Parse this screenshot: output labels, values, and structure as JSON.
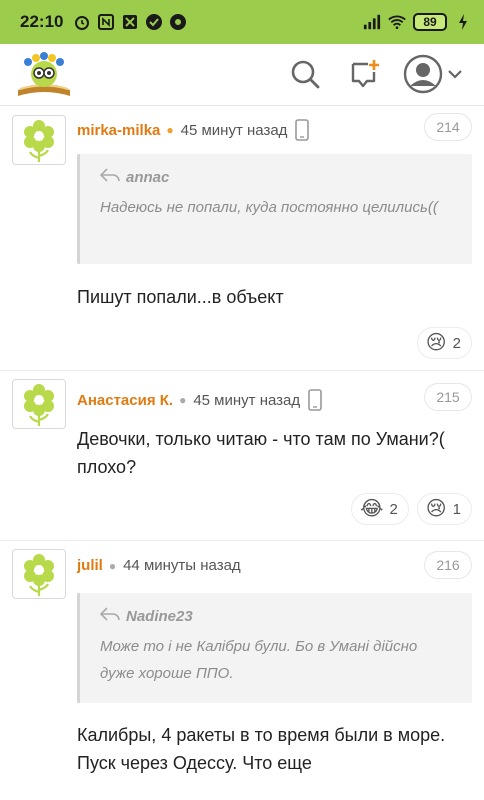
{
  "status": {
    "time": "22:10",
    "battery": "89"
  },
  "header": {
    "logo": "site-logo",
    "search_icon": "search-icon",
    "new_post_icon": "new-post-icon",
    "avatar_icon": "user-avatar-icon"
  },
  "comments": [
    {
      "author": "mirka-milka",
      "time": "45 минут назад",
      "number": "214",
      "quote": {
        "author": "annac",
        "text": "Надеюсь не попали, куда постоянно целились(("
      },
      "text": "Пишут попали...в объект",
      "reactions": [
        {
          "emoji": "😢",
          "count": "2"
        }
      ]
    },
    {
      "author": "Анастасия К.",
      "time": "45 минут назад",
      "number": "215",
      "text": "Девочки, только читаю - что там по Умани?( плохо?",
      "reactions": [
        {
          "emoji": "😂",
          "count": "2"
        },
        {
          "emoji": "😢",
          "count": "1"
        }
      ]
    },
    {
      "author": "julil",
      "time": "44 минуты назад",
      "number": "216",
      "quote": {
        "author": "Nadine23",
        "text": "Може то і не Калібри були. Бо в Умані дійсно дуже хороше ППО."
      },
      "text": "Калибры, 4 ракеты в то время были в море. Пуск через Одессу. Что еще"
    }
  ]
}
